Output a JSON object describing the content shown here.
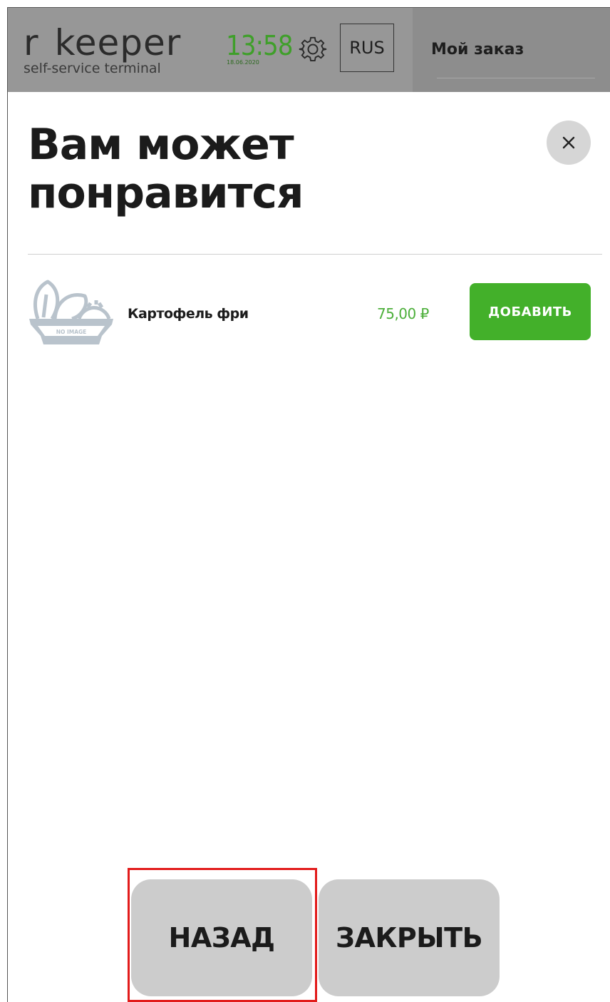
{
  "header": {
    "logo_main_r": "r",
    "logo_main_word": "keeper",
    "logo_sub": "self-service terminal",
    "time": "13:58",
    "date": "18.06.2020",
    "settings_icon": "gear-icon",
    "language": "RUS",
    "order_title": "Мой заказ"
  },
  "popup": {
    "title_line1": "Вам может",
    "title_line2": "понравится",
    "close_icon": "close-icon"
  },
  "items": [
    {
      "image_icon": "no-image-placeholder",
      "image_label": "NO IMAGE",
      "name": "Картофель фри",
      "price": "75,00 ₽",
      "add_label": "ДОБАВИТЬ"
    }
  ],
  "footer": {
    "back_label": "НАЗАД",
    "close_label": "ЗАКРЫТЬ"
  },
  "colors": {
    "header_bg": "#979797",
    "accent_green": "#43b02a",
    "highlight_red": "#e21b1b",
    "button_gray": "#cccccc"
  }
}
